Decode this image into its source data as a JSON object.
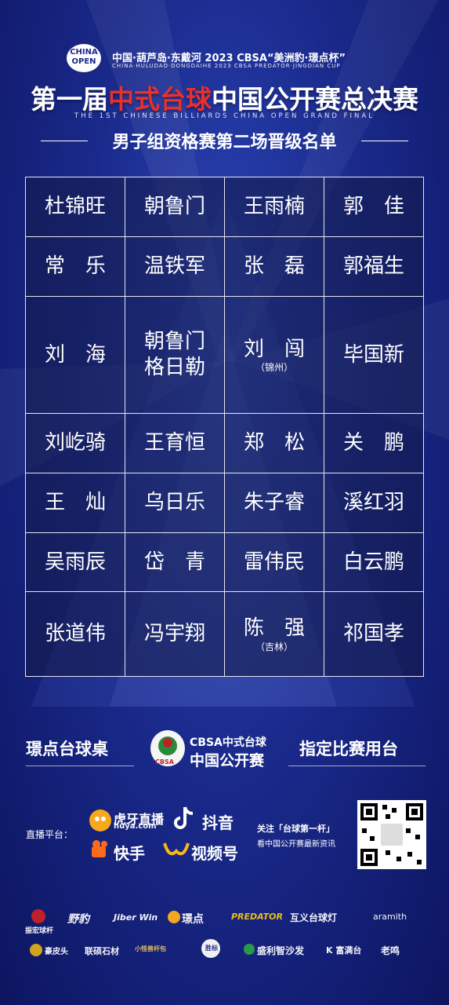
{
  "header": {
    "badge_text": "CHINA OPEN",
    "subtitle_cn": "中国·葫芦岛·东戴河 2023 CBSA“美洲豹·璟点杯”",
    "subtitle_en": "CHINA·HULUDAO·DONGDAIHE 2023 CBSA PREDATOR·JINGDIAN CUP",
    "title_part1": "第一届",
    "title_part2": "中式台球",
    "title_part3": "中国公开赛总决赛",
    "title_en": "THE 1ST CHINESE BILLIARDS CHINA OPEN GRAND FINAL",
    "section_title": "男子组资格赛第二场晋级名单"
  },
  "roster": [
    [
      "杜锦旺",
      "朝鲁门",
      "王雨楠",
      "郭　佳"
    ],
    [
      "常　乐",
      "温铁军",
      "张　磊",
      "郭福生"
    ],
    [
      "刘　海",
      "朝鲁门",
      "刘　闯",
      "毕国新"
    ],
    [
      "刘屹骑",
      "王育恒",
      "郑　松",
      "关　鹏"
    ],
    [
      "王　灿",
      "乌日乐",
      "朱子睿",
      "溪红羽"
    ],
    [
      "吴雨辰",
      "岱　青",
      "雷伟民",
      "白云鹏"
    ],
    [
      "张道伟",
      "冯宇翔",
      "陈　强",
      "祁国孝"
    ]
  ],
  "roster_notes": {
    "r2c1_line2": "格日勒",
    "r2c2_note": "（锦州）",
    "r6c2_note": "（吉林）"
  },
  "sponsors": {
    "left": "璟点台球桌",
    "cbsa_line1": "CBSA中式台球",
    "cbsa_line2": "中国公开赛",
    "cbsa_badge": "CBSA",
    "right": "指定比赛用台"
  },
  "live": {
    "label": "直播平台：",
    "platforms": [
      "虎牙直播",
      "抖音",
      "快手",
      "视频号"
    ],
    "huya_sub": "huya.com",
    "follow_line1": "关注「台球第一杆」",
    "follow_line2": "看中国公开赛最新资讯"
  },
  "brands_row1": [
    "振宏球杆",
    "野豹",
    "Jiber Win",
    "璟点",
    "PREDATOR",
    "互义台球灯",
    "aramith"
  ],
  "brands_row2": [
    "豪皮头",
    "联硕石材",
    "小怪兽杆包",
    "胜标",
    "盛利智沙发",
    "K 富满台",
    "老鸣"
  ],
  "colors": {
    "accent_red": "#e8302f",
    "bg_blue": "#1a2a8c",
    "grid_line": "#e6e6ee"
  }
}
